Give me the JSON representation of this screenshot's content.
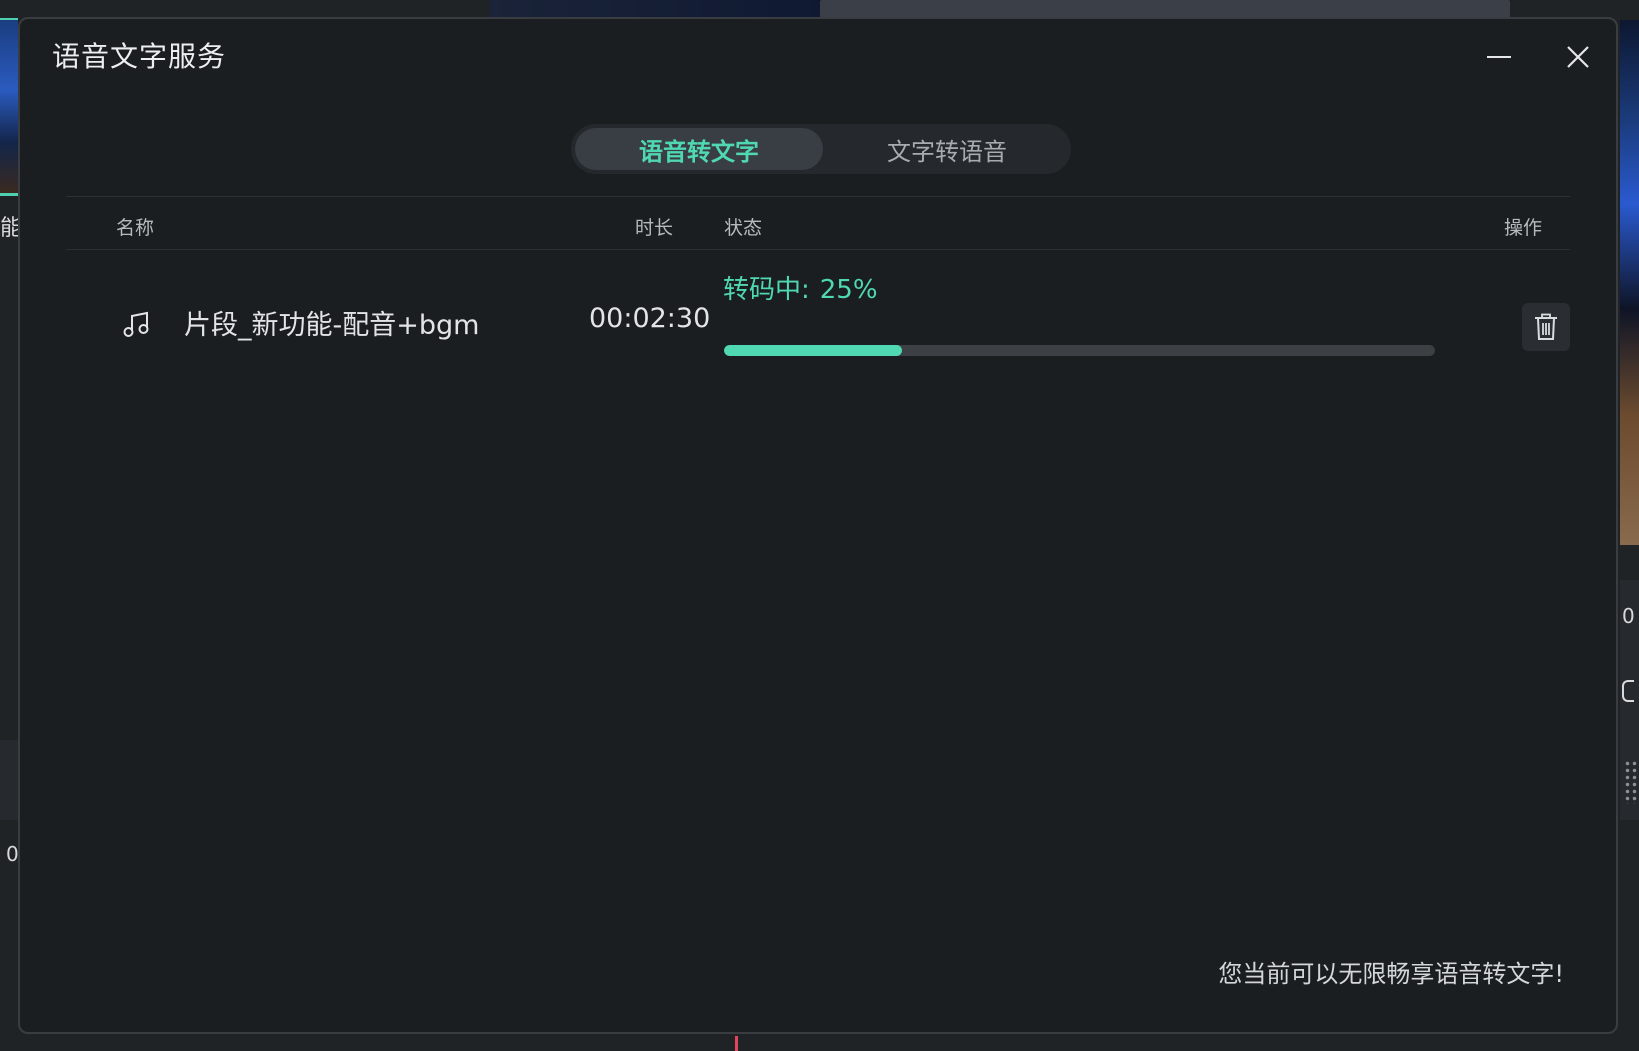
{
  "background": {
    "left_label": "能",
    "left_number": "0",
    "right_number": "0"
  },
  "dialog": {
    "title": "语音文字服务",
    "minimize_icon": "minimize-icon",
    "close_icon": "close-icon"
  },
  "tabs": [
    {
      "label": "语音转文字",
      "active": true
    },
    {
      "label": "文字转语音",
      "active": false
    }
  ],
  "table": {
    "headers": {
      "name": "名称",
      "duration": "时长",
      "status": "状态",
      "action": "操作"
    },
    "rows": [
      {
        "icon": "music-note-icon",
        "name": "片段_新功能-配音+bgm",
        "duration": "00:02:30",
        "status_label": "转码中:",
        "status_percent": "25%",
        "progress": 0.25,
        "action_icon": "trash-icon"
      }
    ]
  },
  "footer": {
    "note": "您当前可以无限畅享语音转文字!"
  },
  "colors": {
    "accent": "#4fd8b2",
    "dialog_bg": "#1b1e21",
    "text": "#e2e4e6"
  }
}
